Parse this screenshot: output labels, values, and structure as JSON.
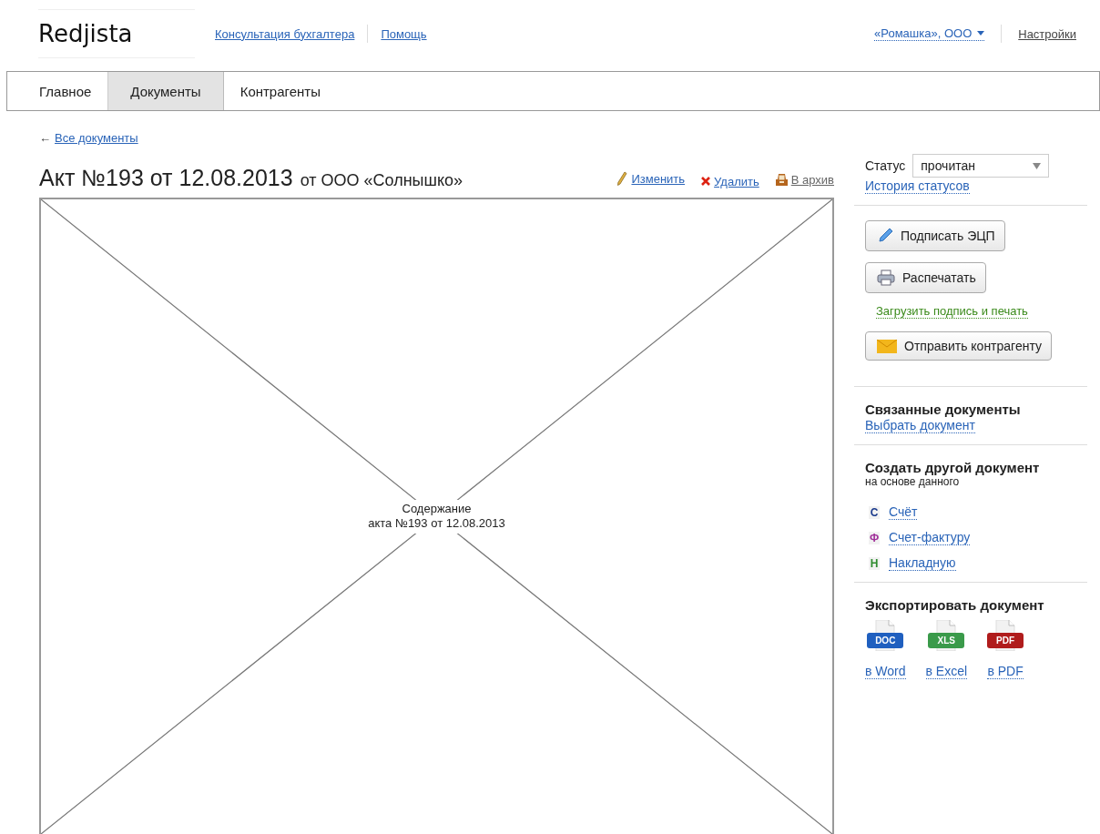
{
  "header": {
    "logo": "Redjista",
    "links": [
      "Консультация бухгалтера",
      "Помощь"
    ],
    "company": "«Ромашка», ООО",
    "settings": "Настройки"
  },
  "tabs": [
    {
      "label": "Главное",
      "selected": false
    },
    {
      "label": "Документы",
      "selected": true
    },
    {
      "label": "Контрагенты",
      "selected": false
    }
  ],
  "back_link": {
    "arrow": "←",
    "label": "Все документы"
  },
  "document": {
    "title": "Акт №193 от 12.08.2013",
    "counterparty": "от ООО «Солнышко»",
    "actions": [
      {
        "kind": "edit",
        "label": "Изменить"
      },
      {
        "kind": "delete",
        "label": "Удалить"
      },
      {
        "kind": "archive",
        "label": "В архив"
      }
    ],
    "content": [
      "Содержание",
      "акта №193 от 12.08.2013"
    ]
  },
  "sidebar": {
    "status": {
      "label": "Статус",
      "value": "прочитан",
      "history": "История статусов"
    },
    "buttons": [
      {
        "kind": "sign",
        "label": "Подписать ЭЦП"
      },
      {
        "kind": "print",
        "label": "Распечатать",
        "note": "Загрузить подпись и печать"
      },
      {
        "kind": "send",
        "label": "Отправить контрагенту"
      }
    ],
    "related": {
      "title": "Связанные документы",
      "link": "Выбрать документ"
    },
    "create": {
      "title": "Создать другой документ",
      "subtitle": "на основе данного",
      "items": [
        {
          "letter": "С",
          "color": "#1b3a8c",
          "label": "Счёт"
        },
        {
          "letter": "Ф",
          "color": "#a0309a",
          "label": "Счет-фактуру"
        },
        {
          "letter": "Н",
          "color": "#2e8b2e",
          "label": "Накладную"
        }
      ]
    },
    "export": {
      "title": "Экспортировать документ",
      "items": [
        {
          "badge": "DOC",
          "color": "#1f5fbf",
          "label": "в Word"
        },
        {
          "badge": "XLS",
          "color": "#3a9a4a",
          "label": "в Excel"
        },
        {
          "badge": "PDF",
          "color": "#b01c1c",
          "label": "в PDF"
        }
      ]
    }
  }
}
